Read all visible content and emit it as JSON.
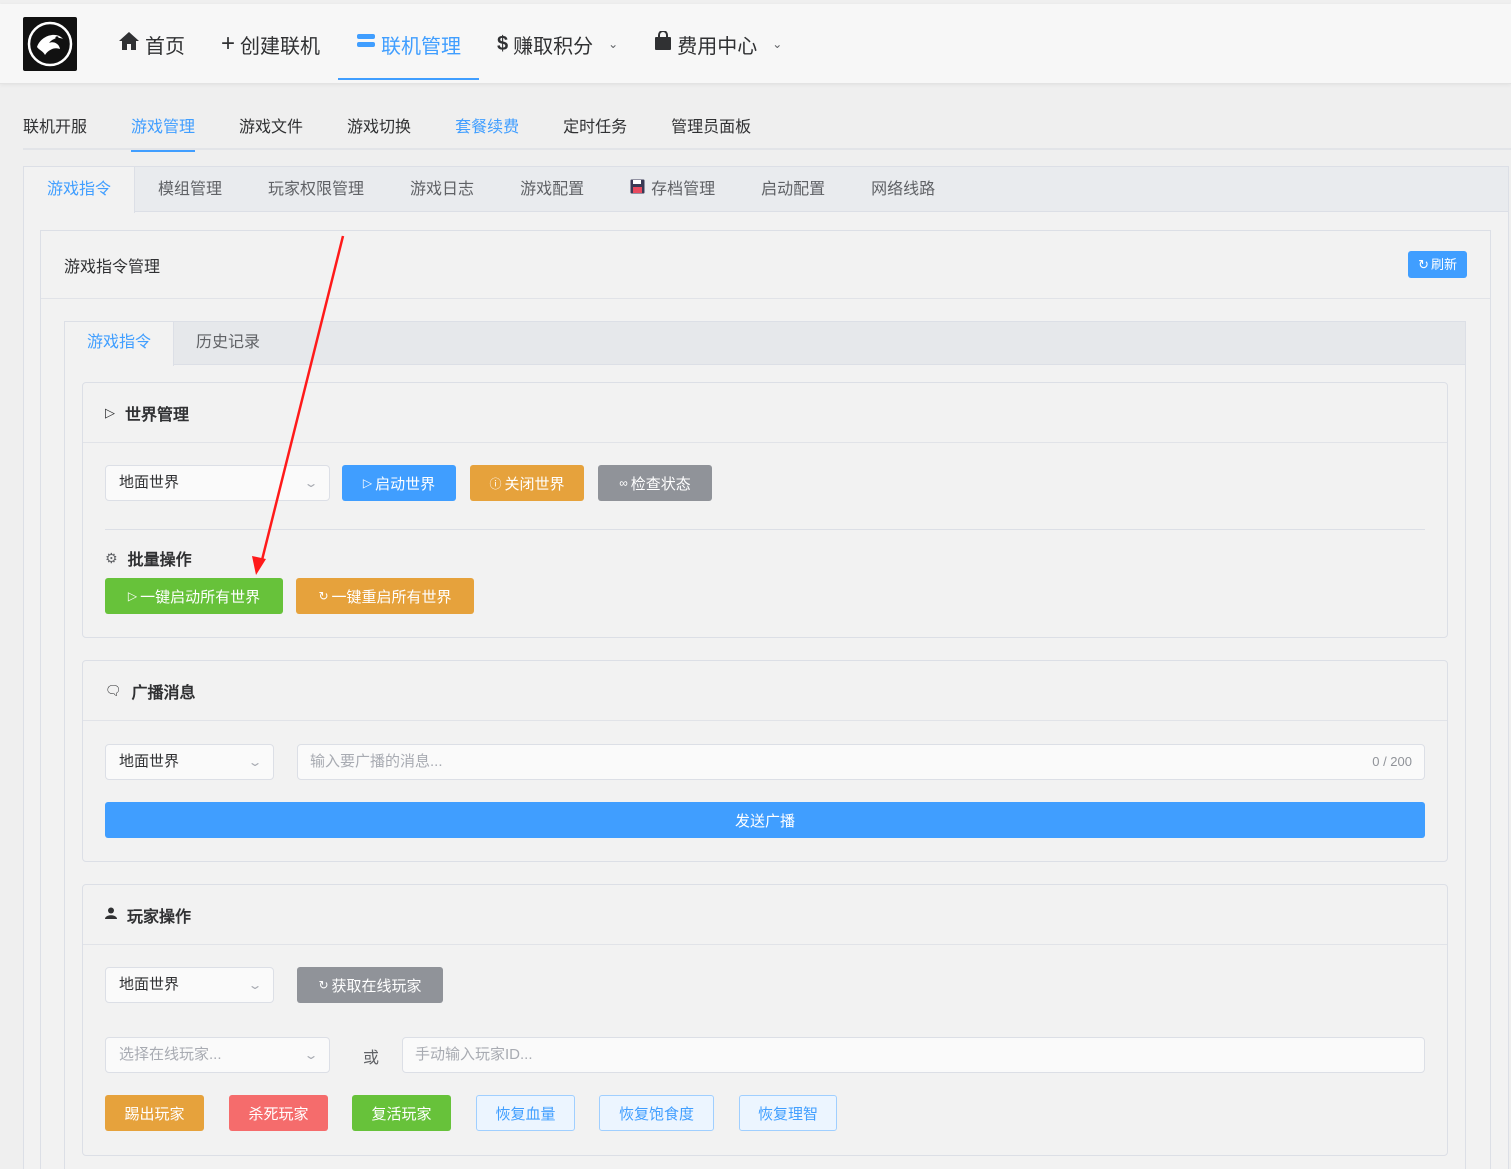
{
  "topnav": {
    "items": [
      {
        "icon": "home-icon",
        "label": "首页"
      },
      {
        "icon": "plus-icon",
        "label": "创建联机"
      },
      {
        "icon": "server-icon",
        "label": "联机管理"
      },
      {
        "icon": "dollar-icon",
        "label": "赚取积分"
      },
      {
        "icon": "bag-icon",
        "label": "费用中心"
      }
    ],
    "active_index": 2
  },
  "subnav": {
    "items": [
      "联机开服",
      "游戏管理",
      "游戏文件",
      "游戏切换",
      "套餐续费",
      "定时任务",
      "管理员面板"
    ],
    "active": "游戏管理"
  },
  "cardtabs": {
    "items": [
      "游戏指令",
      "模组管理",
      "玩家权限管理",
      "游戏日志",
      "游戏配置",
      "存档管理",
      "启动配置",
      "网络线路"
    ],
    "active": "游戏指令"
  },
  "panel": {
    "title": "游戏指令管理",
    "refresh_label": "刷新"
  },
  "innertabs": {
    "items": [
      "游戏指令",
      "历史记录"
    ],
    "active": "游戏指令"
  },
  "world": {
    "title": "世界管理",
    "select_value": "地面世界",
    "start_label": "启动世界",
    "close_label": "关闭世界",
    "check_label": "检查状态",
    "batch_title": "批量操作",
    "start_all_label": "一键启动所有世界",
    "restart_all_label": "一键重启所有世界"
  },
  "broadcast": {
    "title": "广播消息",
    "select_value": "地面世界",
    "input_placeholder": "输入要广播的消息...",
    "count": "0 / 200",
    "send_label": "发送广播"
  },
  "player": {
    "title": "玩家操作",
    "select_value": "地面世界",
    "fetch_label": "获取在线玩家",
    "player_select_placeholder": "选择在线玩家...",
    "or_label": "或",
    "player_id_placeholder": "手动输入玩家ID...",
    "actions": [
      "踢出玩家",
      "杀死玩家",
      "复活玩家",
      "恢复血量",
      "恢复饱食度",
      "恢复理智"
    ]
  },
  "colors": {
    "primary": "#409eff",
    "warning": "#e6a23c",
    "info": "#909399",
    "success": "#67c23a",
    "danger": "#f56c6c",
    "annotation_arrow": "#ff1a1a"
  }
}
